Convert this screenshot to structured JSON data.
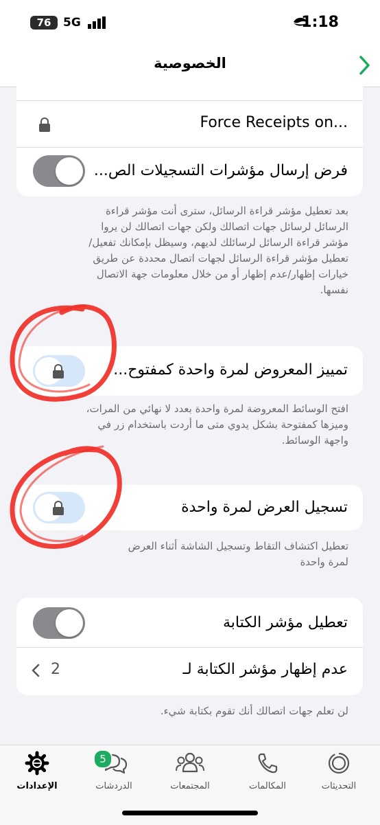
{
  "status_bar": {
    "time": "1:18",
    "battery": "76",
    "network": "5G"
  },
  "header": {
    "title": "الخصوصية"
  },
  "receipts_card": {
    "force_receipts_label": "Force Receipts on...",
    "force_send_label": "فرض إرسال مؤشرات التسجيلات الص...",
    "force_send_toggle": "off"
  },
  "receipts_desc": [
    "بعد تعطيل مؤشر قراءة الرسائل، سترى أنت مؤشر قراءة",
    "الرسائل لرسائل جهات اتصالك ولكن جهات اتصالك لن يروا",
    "مؤشر قراءة الرسائل لرسائلك لديهم، وسيظل بإمكانك تفعيل/",
    "تعطيل مؤشر قراءة الرسائل لجهات اتصال محددة عن طريق",
    "خيارات إظهار/عدم إظهار أو من خلال معلومات جهة الاتصال",
    "نفسها."
  ],
  "view_once_card": {
    "label": "تمييز المعروض لمرة واحدة كمفتوح..."
  },
  "view_once_desc": [
    "افتح الوسائط المعروضة لمرة واحدة بعدد لا نهائي من المرات،",
    "وميزها كمفتوحة بشكل يدوي متى ما أردت باستخدام زر في",
    "واجهة الوسائط."
  ],
  "record_once_card": {
    "label": "تسجيل العرض لمرة واحدة"
  },
  "record_once_desc": [
    "تعطيل اكتشاف التقاط وتسجيل الشاشة أثناء العرض",
    "لمرة واحدة"
  ],
  "typing_card": {
    "disable_typing_label": "تعطيل مؤشر الكتابة",
    "disable_typing_toggle": "off",
    "hide_typing_label": "عدم إظهار مؤشر الكتابة لـ",
    "hide_typing_value": "2"
  },
  "typing_desc": "لن تعلم جهات اتصالك أنك تقوم بكتابة شيء.",
  "tab_bar": {
    "tabs": [
      {
        "label": "التحديثات",
        "icon": "updates-icon"
      },
      {
        "label": "المكالمات",
        "icon": "phone-icon"
      },
      {
        "label": "المجتمعات",
        "icon": "communities-icon"
      },
      {
        "label": "الدردشات",
        "icon": "chats-icon",
        "badge": "5"
      },
      {
        "label": "الإعدادات",
        "icon": "settings-icon",
        "active": true
      }
    ]
  },
  "colors": {
    "accent_green": "#1daa61",
    "background": "#f2f2f7",
    "toggle_off": "#8a8a8e",
    "locked_toggle": "#d6e7f9",
    "annotation_red": "#ee2b22"
  }
}
